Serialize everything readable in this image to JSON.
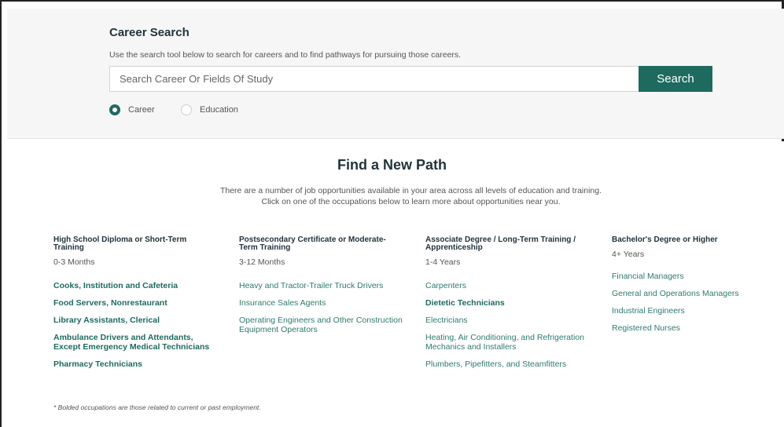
{
  "search": {
    "title": "Career Search",
    "description": "Use the search tool below to search for careers and to find pathways for pursuing those careers.",
    "placeholder": "Search Career Or Fields Of Study",
    "button_label": "Search",
    "options": [
      {
        "label": "Career",
        "selected": true
      },
      {
        "label": "Education",
        "selected": false
      }
    ]
  },
  "find_path": {
    "title": "Find a New Path",
    "desc_line1": "There are a number of job opportunities available in your area across all levels of education and training.",
    "desc_line2": "Click on one of the occupations below to learn more about opportunities near you."
  },
  "columns": [
    {
      "title": "High School Diploma or Short-Term Training",
      "duration": "0-3 Months",
      "occupations": [
        {
          "label": "Cooks, Institution and Cafeteria",
          "bold": true
        },
        {
          "label": "Food Servers, Nonrestaurant",
          "bold": true
        },
        {
          "label": "Library Assistants, Clerical",
          "bold": true
        },
        {
          "label": "Ambulance Drivers and Attendants, Except Emergency Medical Technicians",
          "bold": true
        },
        {
          "label": "Pharmacy Technicians",
          "bold": true
        }
      ]
    },
    {
      "title": "Postsecondary Certificate or Moderate-Term Training",
      "duration": "3-12 Months",
      "occupations": [
        {
          "label": "Heavy and Tractor-Trailer Truck Drivers",
          "bold": false
        },
        {
          "label": "Insurance Sales Agents",
          "bold": false
        },
        {
          "label": "Operating Engineers and Other Construction Equipment Operators",
          "bold": false
        }
      ]
    },
    {
      "title": "Associate Degree / Long-Term Training / Apprenticeship",
      "duration": "1-4 Years",
      "occupations": [
        {
          "label": "Carpenters",
          "bold": false
        },
        {
          "label": "Dietetic Technicians",
          "bold": true
        },
        {
          "label": "Electricians",
          "bold": false
        },
        {
          "label": "Heating, Air Conditioning, and Refrigeration Mechanics and Installers",
          "bold": false
        },
        {
          "label": "Plumbers, Pipefitters, and Steamfitters",
          "bold": false
        }
      ]
    },
    {
      "title": "Bachelor's Degree or Higher",
      "duration": "4+ Years",
      "occupations": [
        {
          "label": "Financial Managers",
          "bold": false
        },
        {
          "label": "General and Operations Managers",
          "bold": false
        },
        {
          "label": "Industrial Engineers",
          "bold": false
        },
        {
          "label": "Registered Nurses",
          "bold": false
        }
      ]
    }
  ],
  "footnote": "* Bolded occupations are those related to current or past employment.",
  "colors": {
    "accent": "#1e6a5f",
    "heading": "#23343b",
    "link": "#2f7a6e"
  }
}
